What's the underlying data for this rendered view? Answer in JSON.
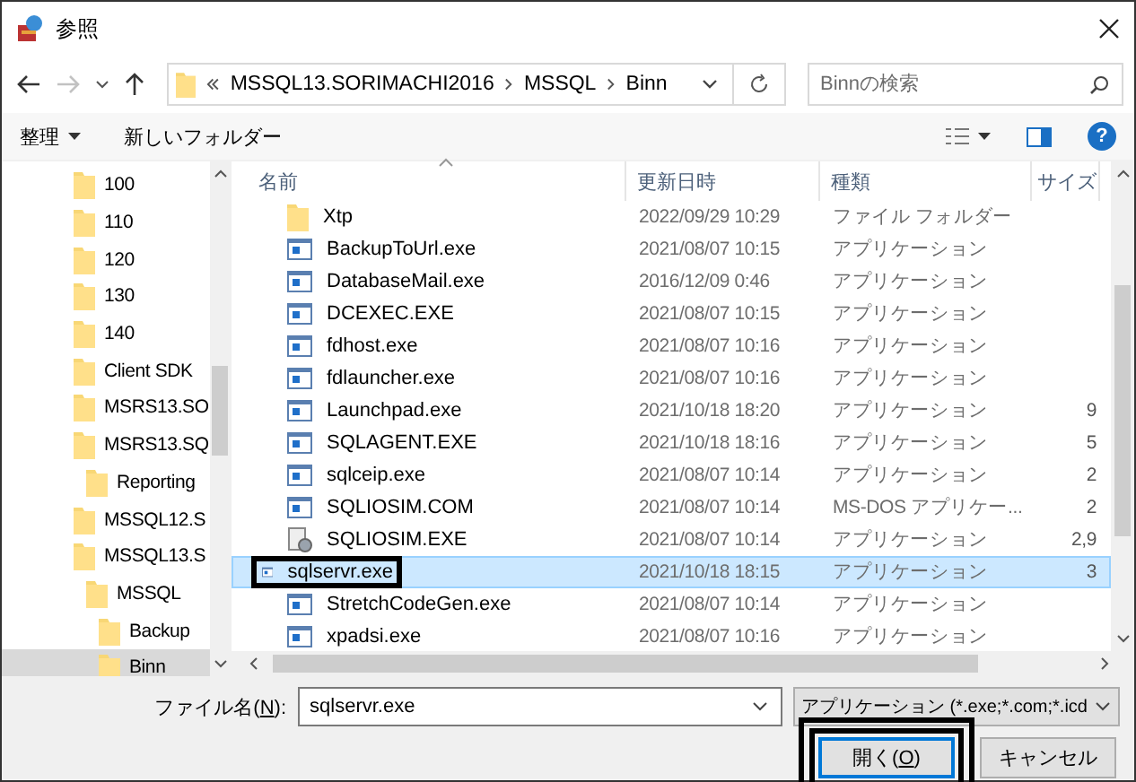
{
  "window": {
    "title": "参照"
  },
  "nav": {
    "back": {
      "disabled": false
    },
    "forward": {
      "disabled": true
    }
  },
  "address": {
    "crumbs": [
      "MSSQL13.SORIMACHI2016",
      "MSSQL",
      "Binn"
    ]
  },
  "search": {
    "placeholder": "Binnの検索"
  },
  "toolbar": {
    "organize": "整理",
    "new_folder": "新しいフォルダー",
    "help": "?"
  },
  "tree": [
    {
      "label": "100",
      "selected": false
    },
    {
      "label": "110",
      "selected": false
    },
    {
      "label": "120",
      "selected": false
    },
    {
      "label": "130",
      "selected": false
    },
    {
      "label": "140",
      "selected": false
    },
    {
      "label": "Client SDK",
      "selected": false
    },
    {
      "label": "MSRS13.SO",
      "selected": false
    },
    {
      "label": "MSRS13.SQ",
      "selected": false,
      "children": [
        {
          "label": "Reporting",
          "selected": false
        }
      ]
    },
    {
      "label": "MSSQL12.S",
      "selected": false
    },
    {
      "label": "MSSQL13.S",
      "selected": false,
      "children": [
        {
          "label": "MSSQL",
          "selected": false,
          "children": [
            {
              "label": "Backup",
              "selected": false
            },
            {
              "label": "Binn",
              "selected": true
            }
          ]
        }
      ]
    }
  ],
  "files": {
    "columns": [
      "名前",
      "更新日時",
      "種類",
      "サイズ"
    ],
    "rows": [
      {
        "kind": "folder",
        "name": "Xtp",
        "date": "2022/09/29 10:29",
        "type": "ファイル フォルダー",
        "selected": false,
        "highlighted": false
      },
      {
        "kind": "app",
        "name": "BackupToUrl.exe",
        "date": "2021/08/07 10:15",
        "type": "アプリケーション",
        "selected": false,
        "highlighted": false
      },
      {
        "kind": "app",
        "name": "DatabaseMail.exe",
        "date": "2016/12/09 0:46",
        "type": "アプリケーション",
        "selected": false,
        "highlighted": false
      },
      {
        "kind": "app",
        "name": "DCEXEC.EXE",
        "date": "2021/08/07 10:15",
        "type": "アプリケーション",
        "selected": false,
        "highlighted": false
      },
      {
        "kind": "app",
        "name": "fdhost.exe",
        "date": "2021/08/07 10:16",
        "type": "アプリケーション",
        "selected": false,
        "highlighted": false
      },
      {
        "kind": "app",
        "name": "fdlauncher.exe",
        "date": "2021/08/07 10:16",
        "type": "アプリケーション",
        "selected": false,
        "highlighted": false
      },
      {
        "kind": "app",
        "name": "Launchpad.exe",
        "date": "2021/10/18 18:20",
        "type": "アプリケーション",
        "size": "9",
        "selected": false,
        "highlighted": false
      },
      {
        "kind": "app",
        "name": "SQLAGENT.EXE",
        "date": "2021/10/18 18:16",
        "type": "アプリケーション",
        "size": "5",
        "selected": false,
        "highlighted": false
      },
      {
        "kind": "app",
        "name": "sqlceip.exe",
        "date": "2021/08/07 10:14",
        "type": "アプリケーション",
        "size": "2",
        "selected": false,
        "highlighted": false
      },
      {
        "kind": "app",
        "name": "SQLIOSIM.COM",
        "date": "2021/08/07 10:14",
        "type": "MS-DOS アプリケー...",
        "size": "2",
        "selected": false,
        "highlighted": false
      },
      {
        "kind": "tool",
        "name": "SQLIOSIM.EXE",
        "date": "2021/08/07 10:14",
        "type": "アプリケーション",
        "size": "2,9",
        "selected": false,
        "highlighted": false
      },
      {
        "kind": "app",
        "name": "sqlservr.exe",
        "date": "2021/10/18 18:15",
        "type": "アプリケーション",
        "size": "3",
        "selected": true,
        "highlighted": true
      },
      {
        "kind": "app",
        "name": "StretchCodeGen.exe",
        "date": "2021/08/07 10:14",
        "type": "アプリケーション",
        "selected": false,
        "highlighted": false
      },
      {
        "kind": "app",
        "name": "xpadsi.exe",
        "date": "2021/08/07 10:16",
        "type": "アプリケーション",
        "selected": false,
        "highlighted": false
      }
    ]
  },
  "footer": {
    "filename_label": {
      "before": "ファイル名(",
      "key": "N",
      "after": "):"
    },
    "filename": "sqlservr.exe",
    "filter": "アプリケーション (*.exe;*.com;*.icd",
    "open": {
      "before": "開く(",
      "key": "O",
      "after": ")",
      "highlighted": true
    },
    "cancel": "キャンセル"
  }
}
